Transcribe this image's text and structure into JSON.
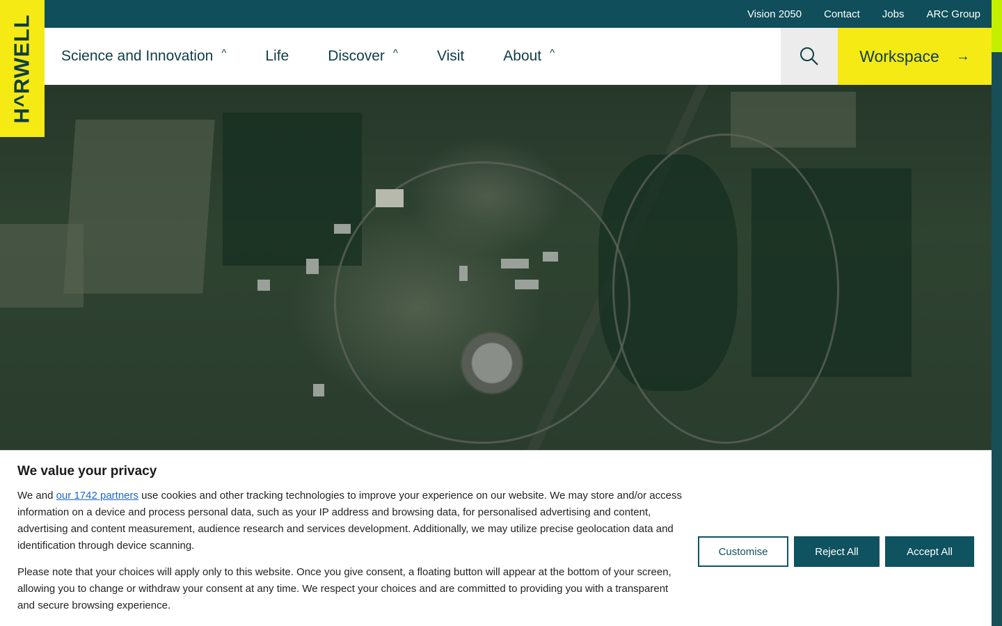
{
  "logo": {
    "text": "H^RWELL"
  },
  "topbar": {
    "links": [
      "Vision 2050",
      "Contact",
      "Jobs",
      "ARC Group"
    ]
  },
  "nav": {
    "items": [
      {
        "label": "Science and Innovation",
        "caret": "^"
      },
      {
        "label": "Life",
        "caret": ""
      },
      {
        "label": "Discover",
        "caret": "^"
      },
      {
        "label": "Visit",
        "caret": ""
      },
      {
        "label": "About",
        "caret": "^"
      }
    ],
    "search_icon": "search-icon",
    "workspace_label": "Workspace",
    "workspace_arrow": "→"
  },
  "colors": {
    "brand_yellow": "#f5ea14",
    "brand_teal": "#0f4e5a",
    "accent_lime": "#c4f000",
    "button_teal": "#0f5260"
  },
  "cookie": {
    "title": "We value your privacy",
    "p1_before": "We and ",
    "p1_link": "our 1742 partners",
    "p1_after": " use cookies and other tracking technologies to improve your experience on our website. We may store and/or access information on a device and process personal data, such as your IP address and browsing data, for personalised advertising and content, advertising and content measurement, audience research and services development. Additionally, we may utilize precise geolocation data and identification through device scanning.",
    "p2": "Please note that your choices will apply only to this website. Once you give consent, a floating button will appear at the bottom of your screen, allowing you to change or withdraw your consent at any time. We respect your choices and are committed to providing you with a transparent and secure browsing experience.",
    "customise_label": "Customise",
    "reject_label": "Reject All",
    "accept_label": "Accept All"
  }
}
